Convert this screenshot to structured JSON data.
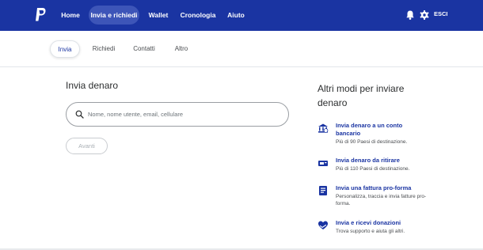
{
  "nav": {
    "items": [
      {
        "label": "Home"
      },
      {
        "label": "Invia e richiedi"
      },
      {
        "label": "Wallet"
      },
      {
        "label": "Cronologia"
      },
      {
        "label": "Aiuto"
      }
    ],
    "logout": "ESCI"
  },
  "subnav": {
    "tabs": [
      {
        "label": "Invia"
      },
      {
        "label": "Richiedi"
      },
      {
        "label": "Contatti"
      },
      {
        "label": "Altro"
      }
    ]
  },
  "send": {
    "title": "Invia denaro",
    "search_placeholder": "Nome, nome utente, email, cellulare",
    "next_label": "Avanti"
  },
  "other": {
    "title": "Altri modi per inviare denaro",
    "options": [
      {
        "title": "Invia denaro a un conto bancario",
        "desc": "Più di 90 Paesi di destinazione."
      },
      {
        "title": "Invia denaro da ritirare",
        "desc": "Più di 110 Paesi di destinazione."
      },
      {
        "title": "Invia una fattura pro-forma",
        "desc": "Personalizza, traccia e invia fatture pro-forma."
      },
      {
        "title": "Invia e ricevi donazioni",
        "desc": "Trova supporto e aiuta gli altri."
      }
    ]
  },
  "colors": {
    "brand": "#1a34a2",
    "active_pill": "#3d55b8"
  }
}
